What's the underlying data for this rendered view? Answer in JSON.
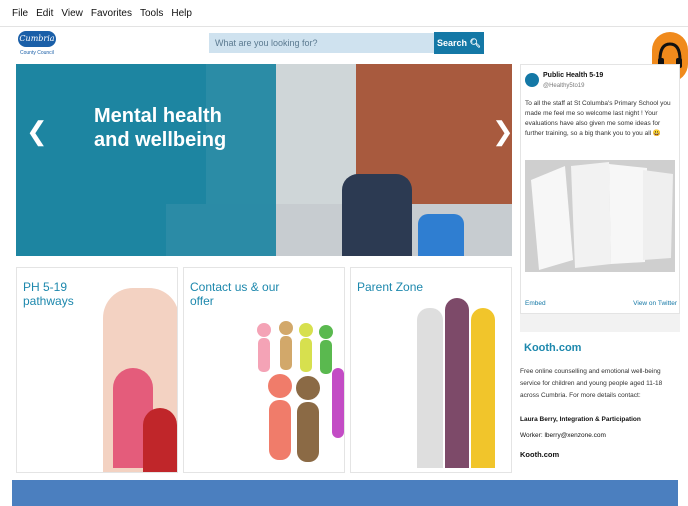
{
  "menubar": {
    "items": [
      "File",
      "Edit",
      "View",
      "Favorites",
      "Tools",
      "Help"
    ]
  },
  "header": {
    "logo_text": "Cumbria",
    "logo_sub": "County Council",
    "search_placeholder": "What are you looking for?",
    "search_button": "Search"
  },
  "hero": {
    "title_line1": "Mental health",
    "title_line2": "and wellbeing"
  },
  "tiles": [
    {
      "title_line1": "PH 5-19",
      "title_line2": "pathways"
    },
    {
      "title_line1": "Contact us & our",
      "title_line2": "offer"
    },
    {
      "title_line1": "Parent Zone",
      "title_line2": ""
    }
  ],
  "tweet": {
    "name": "Public Health 5-19",
    "handle": "@Healthy5to19",
    "text": "To all the staff at St Columba's Primary School you made me feel me so welcome last night ! Your evaluations have also given me some ideas for further training, so a big thank you to you all 😃",
    "embed_label": "Embed",
    "view_label": "View on Twitter"
  },
  "kooth": {
    "title": "Kooth.com",
    "desc": "Free online counselling and emotional well-being service for children and young people aged 11-18 across Cumbria. For more details contact:",
    "contact_name": "Laura Berry, Integration & Participation",
    "worker_label": "Worker:",
    "worker_email": "lberry@xenzone.com",
    "footer_link": "Kooth.com"
  },
  "colors": {
    "accent": "#1d88ad",
    "blue": "#1478a6",
    "band": "#4b7fbf",
    "orange": "#f08a1c"
  },
  "icons": {
    "search": "search-icon",
    "headphones": "headphones-icon"
  }
}
